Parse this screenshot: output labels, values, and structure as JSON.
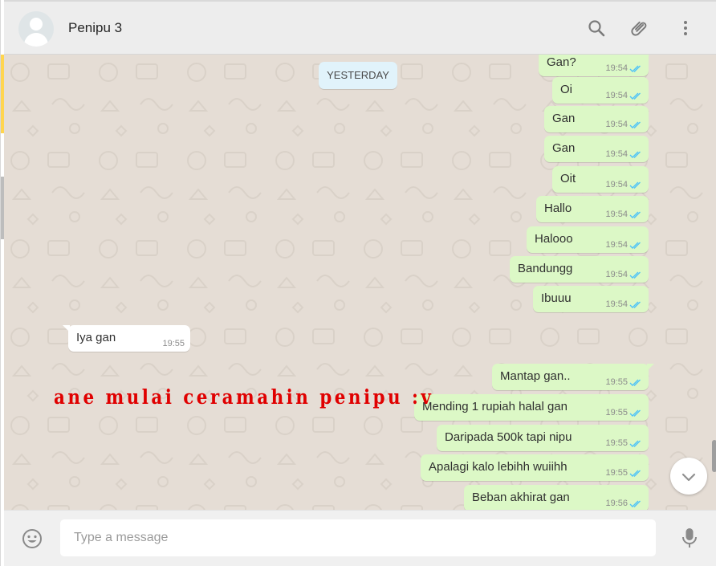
{
  "header": {
    "contact_name": "Penipu 3",
    "icons": [
      "search-icon",
      "attach-icon",
      "menu-icon"
    ]
  },
  "chat": {
    "date_divider": "YESTERDAY",
    "overlay_caption": "ane mulai ceramahin penipu :v",
    "messages": [
      {
        "dir": "out",
        "text": "Gan?",
        "time": "19:54"
      },
      {
        "dir": "out",
        "text": "Oi",
        "time": "19:54"
      },
      {
        "dir": "out",
        "text": "Gan",
        "time": "19:54"
      },
      {
        "dir": "out",
        "text": "Gan",
        "time": "19:54"
      },
      {
        "dir": "out",
        "text": "Oit",
        "time": "19:54"
      },
      {
        "dir": "out",
        "text": "Hallo",
        "time": "19:54"
      },
      {
        "dir": "out",
        "text": "Halooo",
        "time": "19:54"
      },
      {
        "dir": "out",
        "text": "Bandungg",
        "time": "19:54"
      },
      {
        "dir": "out",
        "text": "Ibuuu",
        "time": "19:54"
      },
      {
        "dir": "in",
        "text": "Iya gan",
        "time": "19:55"
      },
      {
        "dir": "out",
        "text": "Mantap gan..",
        "time": "19:55"
      },
      {
        "dir": "out",
        "text": "Mending 1 rupiah halal gan",
        "time": "19:55"
      },
      {
        "dir": "out",
        "text": "Daripada 500k tapi nipu",
        "time": "19:55"
      },
      {
        "dir": "out",
        "text": "Apalagi kalo lebihh wuiihh",
        "time": "19:55"
      },
      {
        "dir": "out",
        "text": "Beban akhirat gan",
        "time": "19:56"
      }
    ]
  },
  "composer": {
    "placeholder": "Type a message",
    "value": ""
  },
  "colors": {
    "outgoing_bubble": "#dcf8c6",
    "incoming_bubble": "#ffffff",
    "chat_background": "#e5ddd5",
    "read_ticks": "#4fc3f7",
    "overlay_caption": "#e00000"
  }
}
